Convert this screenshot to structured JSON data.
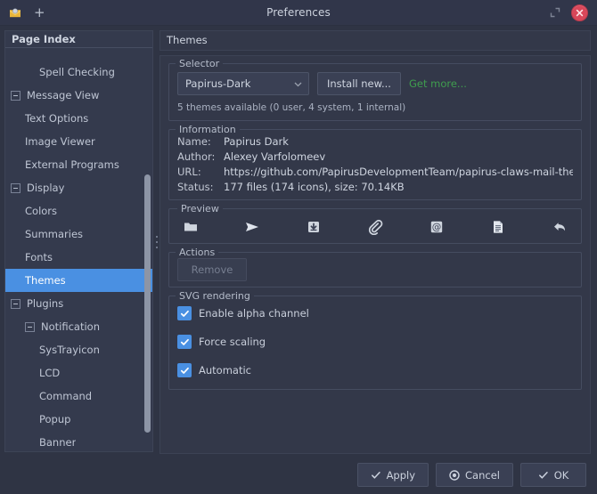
{
  "window": {
    "title": "Preferences",
    "tab_icon": "mail-envelope-icon",
    "new_tab_label": "+",
    "restore_icon": "restore-window-icon",
    "close_icon": "close-window-icon"
  },
  "sidebar": {
    "header": "Page Index",
    "items": [
      {
        "label": "",
        "level": 1,
        "expander": false,
        "selected": false,
        "clipped": true
      },
      {
        "label": "Spell Checking",
        "level": 2,
        "expander": false,
        "selected": false
      },
      {
        "label": "Message View",
        "level": 0,
        "expander": true,
        "selected": false
      },
      {
        "label": "Text Options",
        "level": 1,
        "expander": false,
        "selected": false
      },
      {
        "label": "Image Viewer",
        "level": 1,
        "expander": false,
        "selected": false
      },
      {
        "label": "External Programs",
        "level": 1,
        "expander": false,
        "selected": false
      },
      {
        "label": "Display",
        "level": 0,
        "expander": true,
        "selected": false
      },
      {
        "label": "Colors",
        "level": 1,
        "expander": false,
        "selected": false
      },
      {
        "label": "Summaries",
        "level": 1,
        "expander": false,
        "selected": false
      },
      {
        "label": "Fonts",
        "level": 1,
        "expander": false,
        "selected": false
      },
      {
        "label": "Themes",
        "level": 1,
        "expander": false,
        "selected": true
      },
      {
        "label": "Plugins",
        "level": 0,
        "expander": true,
        "selected": false
      },
      {
        "label": "Notification",
        "level": 1,
        "expander": true,
        "selected": false
      },
      {
        "label": "SysTrayicon",
        "level": 2,
        "expander": false,
        "selected": false
      },
      {
        "label": "LCD",
        "level": 2,
        "expander": false,
        "selected": false
      },
      {
        "label": "Command",
        "level": 2,
        "expander": false,
        "selected": false
      },
      {
        "label": "Popup",
        "level": 2,
        "expander": false,
        "selected": false
      },
      {
        "label": "Banner",
        "level": 2,
        "expander": false,
        "selected": false
      },
      {
        "label": "",
        "level": 2,
        "expander": false,
        "selected": false,
        "clipped": true
      }
    ]
  },
  "main": {
    "page_title": "Themes",
    "selector": {
      "title": "Selector",
      "theme_value": "Papirus-Dark",
      "install_label": "Install new...",
      "get_more_label": "Get more...",
      "note": "5 themes available (0 user, 4 system, 1 internal)"
    },
    "information": {
      "title": "Information",
      "rows": [
        {
          "key": "Name:",
          "value": "Papirus Dark"
        },
        {
          "key": "Author:",
          "value": "Alexey Varfolomeev"
        },
        {
          "key": "URL:",
          "value": "https://github.com/PapirusDevelopmentTeam/papirus-claws-mail-theme"
        },
        {
          "key": "Status:",
          "value": "177 files (174 icons), size: 70.14KB"
        }
      ]
    },
    "preview": {
      "title": "Preview",
      "icons": [
        "folder-icon",
        "send-icon",
        "receive-inbox-icon",
        "attach-paperclip-icon",
        "address-book-at-icon",
        "document-icon",
        "reply-arrow-icon"
      ]
    },
    "actions": {
      "title": "Actions",
      "remove_label": "Remove",
      "remove_disabled": true
    },
    "svg_rendering": {
      "title": "SVG rendering",
      "options": [
        {
          "label": "Enable alpha channel",
          "checked": true
        },
        {
          "label": "Force scaling",
          "checked": true
        },
        {
          "label": "Automatic",
          "checked": true
        }
      ]
    }
  },
  "footer": {
    "apply_label": "Apply",
    "cancel_label": "Cancel",
    "ok_label": "OK"
  },
  "colors": {
    "window_bg": "#2f3444",
    "panel_bg": "#333849",
    "sidebar_bg": "#343a4d",
    "accent_selection": "#4a90e2",
    "link_green": "#3f9e4e",
    "close_red": "#d9475a",
    "text": "#c3c8d4"
  }
}
